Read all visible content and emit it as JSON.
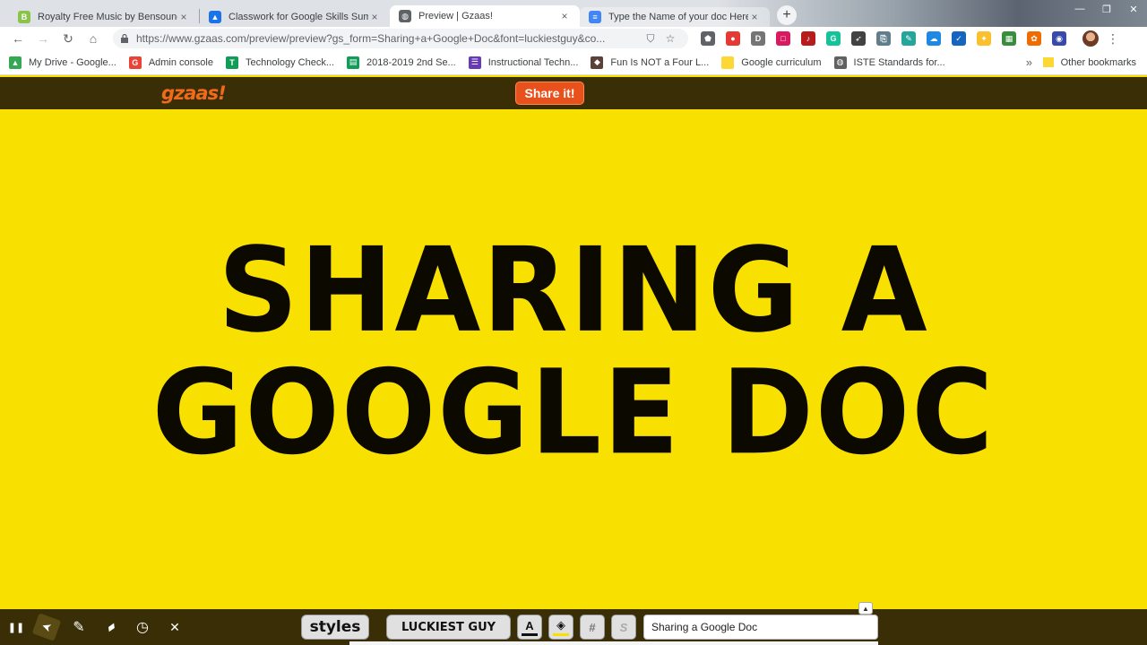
{
  "browser": {
    "tabs": [
      {
        "title": "Royalty Free Music by Bensound",
        "icon_color": "#8bc34a",
        "icon_letter": "B",
        "active": false
      },
      {
        "title": "Classwork for Google Skills Summ",
        "icon_color": "#1a73e8",
        "icon_letter": "▲",
        "active": false
      },
      {
        "title": "Preview | Gzaas!",
        "icon_color": "#5f6368",
        "icon_letter": "◍",
        "active": true
      },
      {
        "title": "Type the Name of your doc Here",
        "icon_color": "#4285f4",
        "icon_letter": "≡",
        "active": false
      }
    ],
    "close_glyph": "×",
    "new_tab_glyph": "+",
    "window_controls": {
      "minimize": "—",
      "maximize": "❐",
      "close": "✕"
    },
    "nav": {
      "back": "←",
      "forward": "→",
      "reload": "↻",
      "home": "⌂"
    },
    "url": "https://www.gzaas.com/preview/preview?gs_form=Sharing+a+Google+Doc&font=luckiestguy&co...",
    "omnibox_icons": {
      "shield": "⛉",
      "star": "☆"
    },
    "extensions": [
      {
        "icon": "pin-icon",
        "color": "#5f6368",
        "glyph": "⬟"
      },
      {
        "icon": "dots-icon",
        "color": "#e53935",
        "glyph": "●"
      },
      {
        "icon": "d-icon",
        "color": "#757575",
        "glyph": "D"
      },
      {
        "icon": "square-icon",
        "color": "#d81b60",
        "glyph": "□"
      },
      {
        "icon": "speaker-icon",
        "color": "#b71c1c",
        "glyph": "♪"
      },
      {
        "icon": "grammarly-icon",
        "color": "#15c39a",
        "glyph": "G"
      },
      {
        "icon": "rocket-icon",
        "color": "#424242",
        "glyph": "➶"
      },
      {
        "icon": "clip-icon",
        "color": "#607d8b",
        "glyph": "⎘"
      },
      {
        "icon": "note-icon",
        "color": "#26a69a",
        "glyph": "✎"
      },
      {
        "icon": "new-badge-icon",
        "color": "#1e88e5",
        "glyph": "☁"
      },
      {
        "icon": "check-icon",
        "color": "#1565c0",
        "glyph": "✓"
      },
      {
        "icon": "bee-icon",
        "color": "#fbc02d",
        "glyph": "✦"
      },
      {
        "icon": "classroom-icon",
        "color": "#388e3c",
        "glyph": "▦"
      },
      {
        "icon": "orange-icon",
        "color": "#ef6c00",
        "glyph": "✿"
      },
      {
        "icon": "globe-icon",
        "color": "#3949ab",
        "glyph": "◉"
      }
    ],
    "menu_glyph": "⋮",
    "bookmarks": [
      {
        "label": "My Drive - Google...",
        "color": "#34a853",
        "glyph": "▲"
      },
      {
        "label": "Admin console",
        "color": "#ea4335",
        "glyph": "G"
      },
      {
        "label": "Technology Check...",
        "color": "#0f9d58",
        "glyph": "T"
      },
      {
        "label": "2018-2019 2nd Se...",
        "color": "#0f9d58",
        "glyph": "▤"
      },
      {
        "label": "Instructional Techn...",
        "color": "#673ab7",
        "glyph": "☰"
      },
      {
        "label": "Fun Is NOT a Four L...",
        "color": "#5d4037",
        "glyph": "◆"
      },
      {
        "label": "Google curriculum",
        "color": "#fdd835",
        "glyph": ""
      },
      {
        "label": "ISTE Standards for...",
        "color": "#616161",
        "glyph": "◍"
      }
    ],
    "bookmarks_more": "»",
    "other_bookmarks": "Other bookmarks"
  },
  "gzaas": {
    "logo": "gzaas!",
    "share_label": "Share it!",
    "message": "Sharing a Google Doc",
    "toolbar": {
      "pause": "❚❚",
      "pointer": "➤",
      "pen": "✎",
      "highlighter": "▰",
      "timer": "◷",
      "close": "✕",
      "styles_label": "styles",
      "font_label": "LUCKIEST GUY",
      "font_color_glyph": "A",
      "bg_color_glyph": "◈",
      "pattern_glyph": "#",
      "shadow_glyph": "S",
      "text_value": "Sharing a Google Doc",
      "caret_glyph": "▲"
    },
    "colors": {
      "background": "#f8e000",
      "text": "#0c0a00",
      "accent": "#e8501c"
    }
  }
}
